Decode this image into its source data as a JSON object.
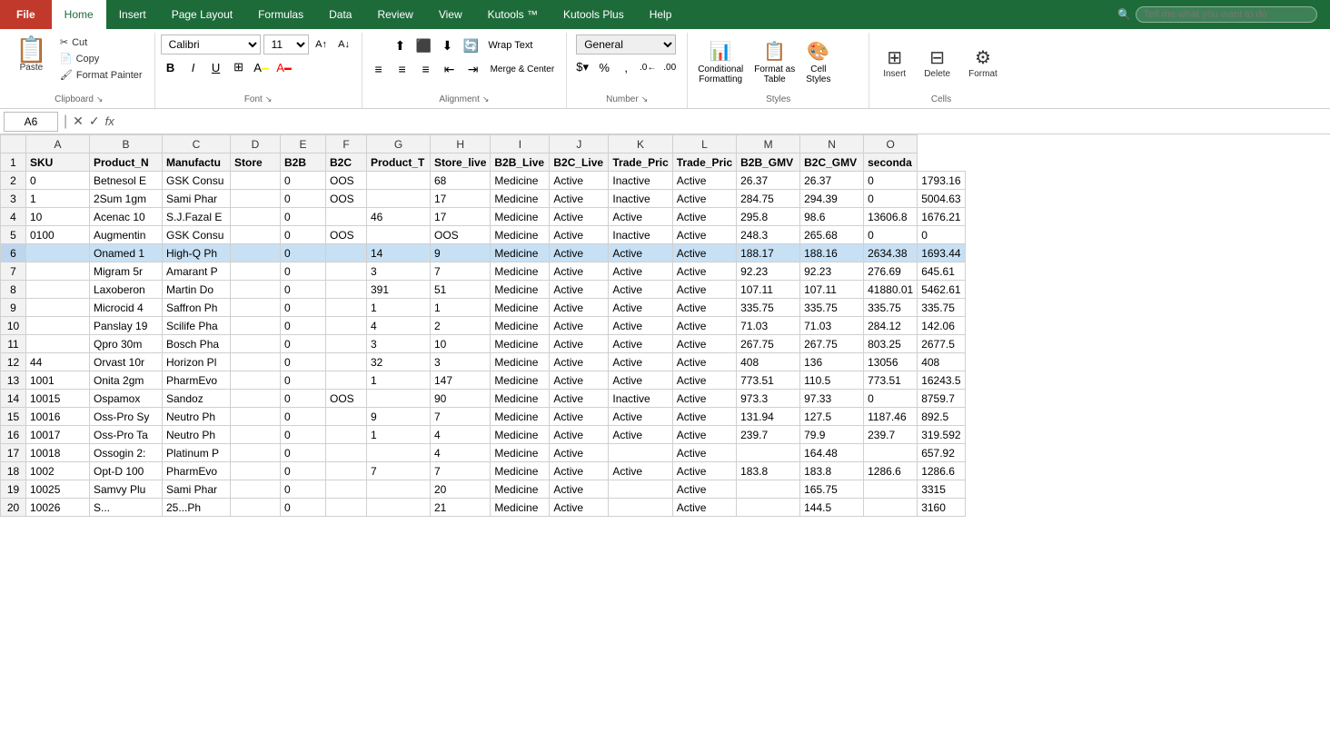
{
  "tabs": {
    "file": "File",
    "home": "Home",
    "insert": "Insert",
    "pageLayout": "Page Layout",
    "formulas": "Formulas",
    "data": "Data",
    "review": "Review",
    "view": "View",
    "kutools": "Kutools ™",
    "kutoolsPlus": "Kutools Plus",
    "help": "Help",
    "tellMe": "Tell me what you want to do"
  },
  "clipboard": {
    "paste": "Paste",
    "cut": "✂ Cut",
    "copy": "Copy",
    "formatPainter": "Format Painter",
    "groupLabel": "Clipboard"
  },
  "font": {
    "name": "Calibri",
    "size": "11",
    "bold": "B",
    "italic": "I",
    "underline": "U",
    "groupLabel": "Font"
  },
  "alignment": {
    "groupLabel": "Alignment",
    "wrapText": "Wrap Text",
    "mergeCenter": "Merge & Center"
  },
  "number": {
    "format": "General",
    "groupLabel": "Number"
  },
  "styles": {
    "conditional": "Conditional\nFormatting",
    "formatTable": "Format as\nTable",
    "cellStyles": "Cell\nStyles",
    "groupLabel": "Styles"
  },
  "cells": {
    "insert": "Insert",
    "delete": "Delete",
    "format": "Format",
    "groupLabel": "Cells"
  },
  "formulaBar": {
    "cellRef": "A6",
    "formula": ""
  },
  "columns": [
    "",
    "A",
    "B",
    "C",
    "D",
    "E",
    "F",
    "G",
    "H",
    "I",
    "J",
    "K",
    "L",
    "M",
    "N",
    "O"
  ],
  "headers": [
    "SKU",
    "Product_N",
    "Manufactu",
    "Store",
    "B2B",
    "B2C",
    "Product_T",
    "Store_live",
    "B2B_Live",
    "B2C_Live",
    "Trade_Pric",
    "Trade_Pric",
    "B2B_GMV",
    "B2C_GMV",
    "seconda"
  ],
  "rows": [
    {
      "num": 2,
      "cells": [
        "0",
        "Betnesol E",
        "GSK Consu",
        "",
        "0",
        "OOS",
        "",
        "68",
        "Medicine",
        "Active",
        "Inactive",
        "Active",
        "26.37",
        "26.37",
        "0",
        "1793.16"
      ]
    },
    {
      "num": 3,
      "cells": [
        "1",
        "2Sum 1gm",
        "Sami Phar",
        "",
        "0",
        "OOS",
        "",
        "17",
        "Medicine",
        "Active",
        "Inactive",
        "Active",
        "284.75",
        "294.39",
        "0",
        "5004.63"
      ]
    },
    {
      "num": 4,
      "cells": [
        "10",
        "Acenac 10",
        "S.J.Fazal E",
        "",
        "0",
        "",
        "46",
        "17",
        "Medicine",
        "Active",
        "Active",
        "Active",
        "295.8",
        "98.6",
        "13606.8",
        "1676.21"
      ]
    },
    {
      "num": 5,
      "cells": [
        "0100",
        "Augmentin",
        "GSK Consu",
        "",
        "0",
        "OOS",
        "",
        "OOS",
        "Medicine",
        "Active",
        "Inactive",
        "Active",
        "248.3",
        "265.68",
        "0",
        "0"
      ]
    },
    {
      "num": 6,
      "cells": [
        "",
        "Onamed 1",
        "High-Q Ph",
        "",
        "0",
        "",
        "14",
        "9",
        "Medicine",
        "Active",
        "Active",
        "Active",
        "188.17",
        "188.16",
        "2634.38",
        "1693.44"
      ]
    },
    {
      "num": 7,
      "cells": [
        "",
        "Migram 5r",
        "Amarant P",
        "",
        "0",
        "",
        "3",
        "7",
        "Medicine",
        "Active",
        "Active",
        "Active",
        "92.23",
        "92.23",
        "276.69",
        "645.61"
      ]
    },
    {
      "num": 8,
      "cells": [
        "",
        "Laxoberon",
        "Martin Do",
        "",
        "0",
        "",
        "391",
        "51",
        "Medicine",
        "Active",
        "Active",
        "Active",
        "107.11",
        "107.11",
        "41880.01",
        "5462.61"
      ]
    },
    {
      "num": 9,
      "cells": [
        "",
        "Microcid 4",
        "Saffron Ph",
        "",
        "0",
        "",
        "1",
        "1",
        "Medicine",
        "Active",
        "Active",
        "Active",
        "335.75",
        "335.75",
        "335.75",
        "335.75"
      ]
    },
    {
      "num": 10,
      "cells": [
        "",
        "Panslay 19",
        "Scilife Pha",
        "",
        "0",
        "",
        "4",
        "2",
        "Medicine",
        "Active",
        "Active",
        "Active",
        "71.03",
        "71.03",
        "284.12",
        "142.06"
      ]
    },
    {
      "num": 11,
      "cells": [
        "",
        "Qpro 30m",
        "Bosch Pha",
        "",
        "0",
        "",
        "3",
        "10",
        "Medicine",
        "Active",
        "Active",
        "Active",
        "267.75",
        "267.75",
        "803.25",
        "2677.5"
      ]
    },
    {
      "num": 12,
      "cells": [
        "44",
        "Orvast 10r",
        "Horizon Pl",
        "",
        "0",
        "",
        "32",
        "3",
        "Medicine",
        "Active",
        "Active",
        "Active",
        "408",
        "136",
        "13056",
        "408"
      ]
    },
    {
      "num": 13,
      "cells": [
        "1001",
        "Onita 2gm",
        "PharmEvo",
        "",
        "0",
        "",
        "1",
        "147",
        "Medicine",
        "Active",
        "Active",
        "Active",
        "773.51",
        "110.5",
        "773.51",
        "16243.5"
      ]
    },
    {
      "num": 14,
      "cells": [
        "10015",
        "Ospamox",
        "Sandoz",
        "",
        "0",
        "OOS",
        "",
        "90",
        "Medicine",
        "Active",
        "Inactive",
        "Active",
        "973.3",
        "97.33",
        "0",
        "8759.7"
      ]
    },
    {
      "num": 15,
      "cells": [
        "10016",
        "Oss-Pro Sy",
        "Neutro Ph",
        "",
        "0",
        "",
        "9",
        "7",
        "Medicine",
        "Active",
        "Active",
        "Active",
        "131.94",
        "127.5",
        "1187.46",
        "892.5"
      ]
    },
    {
      "num": 16,
      "cells": [
        "10017",
        "Oss-Pro Ta",
        "Neutro Ph",
        "",
        "0",
        "",
        "1",
        "4",
        "Medicine",
        "Active",
        "Active",
        "Active",
        "239.7",
        "79.9",
        "239.7",
        "319.592"
      ]
    },
    {
      "num": 17,
      "cells": [
        "10018",
        "Ossogin 2:",
        "Platinum P",
        "",
        "0",
        "",
        "",
        "4",
        "Medicine",
        "Active",
        "",
        "Active",
        "",
        "164.48",
        "",
        "657.92"
      ]
    },
    {
      "num": 18,
      "cells": [
        "1002",
        "Opt-D 100",
        "PharmEvo",
        "",
        "0",
        "",
        "7",
        "7",
        "Medicine",
        "Active",
        "Active",
        "Active",
        "183.8",
        "183.8",
        "1286.6",
        "1286.6"
      ]
    },
    {
      "num": 19,
      "cells": [
        "10025",
        "Samvy Plu",
        "Sami Phar",
        "",
        "0",
        "",
        "",
        "20",
        "Medicine",
        "Active",
        "",
        "Active",
        "",
        "165.75",
        "",
        "3315"
      ]
    },
    {
      "num": 20,
      "cells": [
        "10026",
        "S...",
        "25...Ph",
        "",
        "0",
        "",
        "",
        "21",
        "Medicine",
        "Active",
        "",
        "Active",
        "",
        "144.5",
        "",
        "3160"
      ]
    }
  ]
}
